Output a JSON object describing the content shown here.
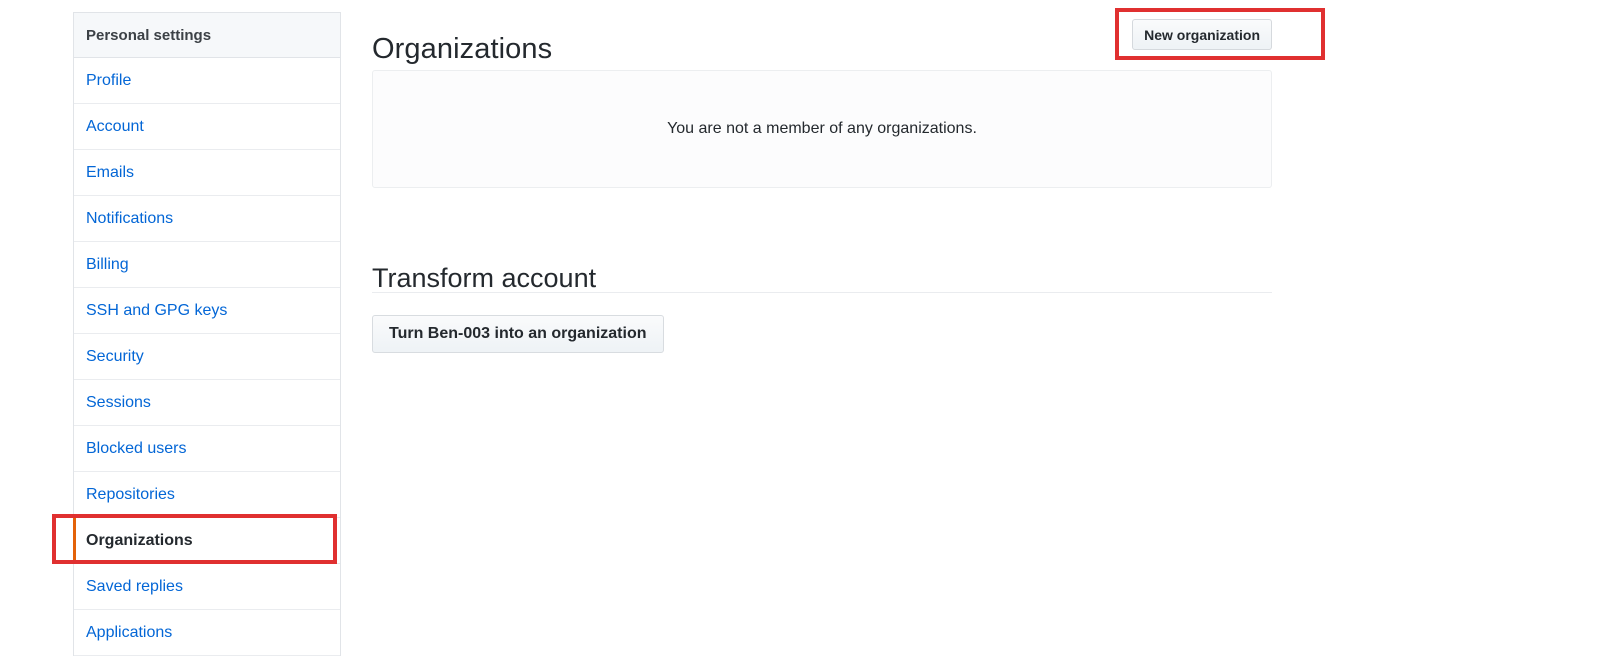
{
  "sidebar": {
    "header": "Personal settings",
    "items": [
      {
        "label": "Profile",
        "selected": false
      },
      {
        "label": "Account",
        "selected": false
      },
      {
        "label": "Emails",
        "selected": false
      },
      {
        "label": "Notifications",
        "selected": false
      },
      {
        "label": "Billing",
        "selected": false
      },
      {
        "label": "SSH and GPG keys",
        "selected": false
      },
      {
        "label": "Security",
        "selected": false
      },
      {
        "label": "Sessions",
        "selected": false
      },
      {
        "label": "Blocked users",
        "selected": false
      },
      {
        "label": "Repositories",
        "selected": false
      },
      {
        "label": "Organizations",
        "selected": true
      },
      {
        "label": "Saved replies",
        "selected": false
      },
      {
        "label": "Applications",
        "selected": false
      }
    ]
  },
  "main": {
    "page_title": "Organizations",
    "new_organization_button": "New organization",
    "empty_state_text": "You are not a member of any organizations.",
    "transform_heading": "Transform account",
    "transform_button": "Turn Ben-003 into an organization"
  },
  "colors": {
    "link": "#0366d6",
    "selected_accent": "#e36209",
    "annotation": "#e03030",
    "header_bg": "#f6f8fa",
    "border": "#e1e4e8"
  }
}
